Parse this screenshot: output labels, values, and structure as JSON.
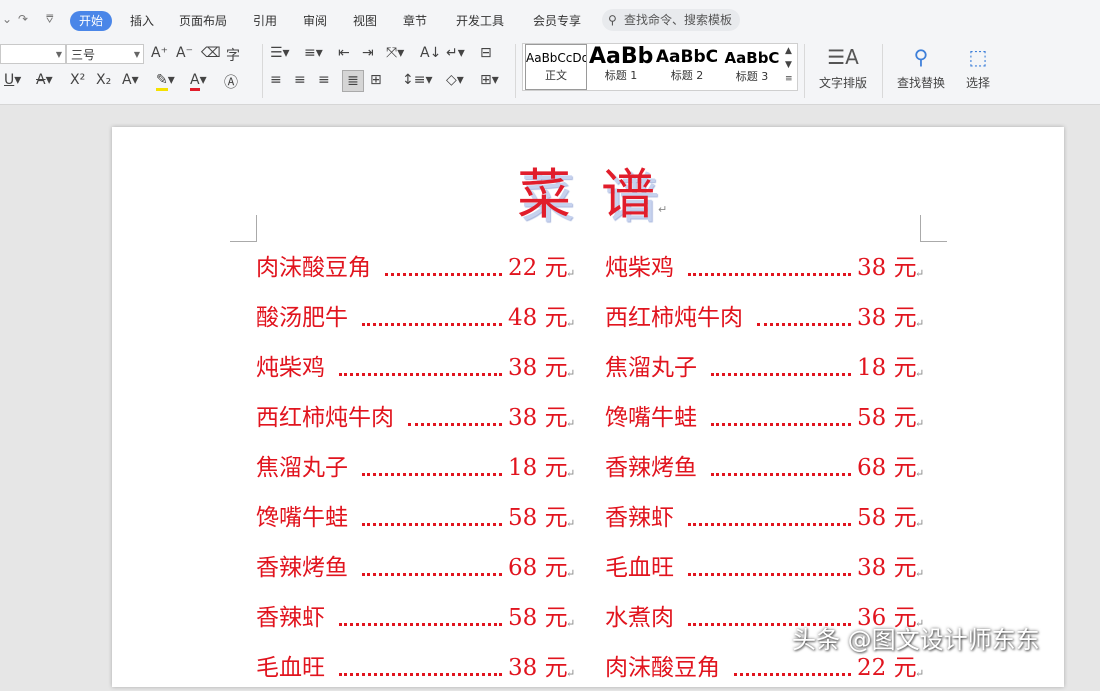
{
  "tabs": [
    "开始",
    "插入",
    "页面布局",
    "引用",
    "审阅",
    "视图",
    "章节",
    "开发工具",
    "会员专享"
  ],
  "active_tab": "开始",
  "search_placeholder": "查找命令、搜索模板",
  "font_size_value": "三号",
  "styles": [
    {
      "preview": "AaBbCcDd",
      "label": "正文"
    },
    {
      "preview": "AaBb",
      "label": "标题 1"
    },
    {
      "preview": "AaBbC",
      "label": "标题 2"
    },
    {
      "preview": "AaBbC",
      "label": "标题 3"
    }
  ],
  "ribbon_buttons": {
    "text_layout": "文字排版",
    "find_replace": "查找替换",
    "select": "选择"
  },
  "document": {
    "title": "菜谱",
    "left_column": [
      {
        "dish": "肉沫酸豆角",
        "price": "22 元"
      },
      {
        "dish": "酸汤肥牛",
        "price": "48 元"
      },
      {
        "dish": "炖柴鸡",
        "price": "38 元"
      },
      {
        "dish": "西红柿炖牛肉",
        "price": "38 元"
      },
      {
        "dish": "焦溜丸子",
        "price": "18 元"
      },
      {
        "dish": "馋嘴牛蛙",
        "price": "58 元"
      },
      {
        "dish": "香辣烤鱼",
        "price": "68 元"
      },
      {
        "dish": "香辣虾",
        "price": "58 元"
      },
      {
        "dish": "毛血旺",
        "price": "38 元"
      }
    ],
    "right_column": [
      {
        "dish": "炖柴鸡",
        "price": "38 元"
      },
      {
        "dish": "西红柿炖牛肉",
        "price": "38 元"
      },
      {
        "dish": "焦溜丸子",
        "price": "18 元"
      },
      {
        "dish": "馋嘴牛蛙",
        "price": "58 元"
      },
      {
        "dish": "香辣烤鱼",
        "price": "68 元"
      },
      {
        "dish": "香辣虾",
        "price": "58 元"
      },
      {
        "dish": "毛血旺",
        "price": "38 元"
      },
      {
        "dish": "水煮肉",
        "price": "36 元"
      },
      {
        "dish": "肉沫酸豆角",
        "price": "22 元"
      }
    ]
  },
  "watermark": "头条 @图文设计师东东",
  "colors": {
    "menu_text": "#e1141e",
    "accent_tab": "#4a86e8"
  }
}
